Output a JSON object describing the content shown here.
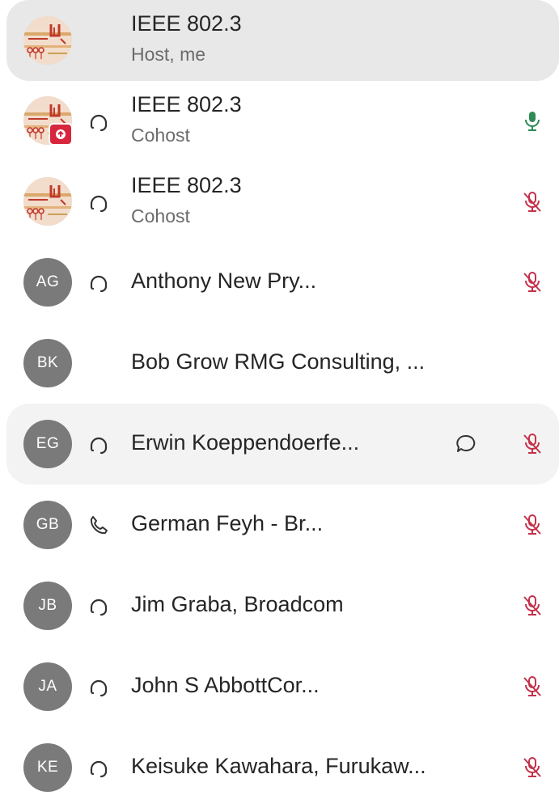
{
  "participants": [
    {
      "name": "IEEE 802.3",
      "role": "Host, me"
    },
    {
      "name": "IEEE 802.3",
      "role": "Cohost"
    },
    {
      "name": "IEEE 802.3",
      "role": "Cohost"
    },
    {
      "name": "Anthony New Pry...",
      "initials": "AG"
    },
    {
      "name": "Bob Grow RMG Consulting, ...",
      "initials": "BK"
    },
    {
      "name": "Erwin Koeppendoerfe...",
      "initials": "EG"
    },
    {
      "name": "German Feyh - Br...",
      "initials": "GB"
    },
    {
      "name": "Jim Graba, Broadcom",
      "initials": "JB"
    },
    {
      "name": "John S AbbottCor...",
      "initials": "JA"
    },
    {
      "name": "Keisuke Kawahara, Furukaw...",
      "initials": "KE"
    }
  ],
  "colors": {
    "mic_on": "#2e8b57",
    "mic_muted": "#c4314b",
    "avatar_gray": "#7a7a7a",
    "share_badge": "#d7263d",
    "highlight": "#e8e8e8"
  }
}
